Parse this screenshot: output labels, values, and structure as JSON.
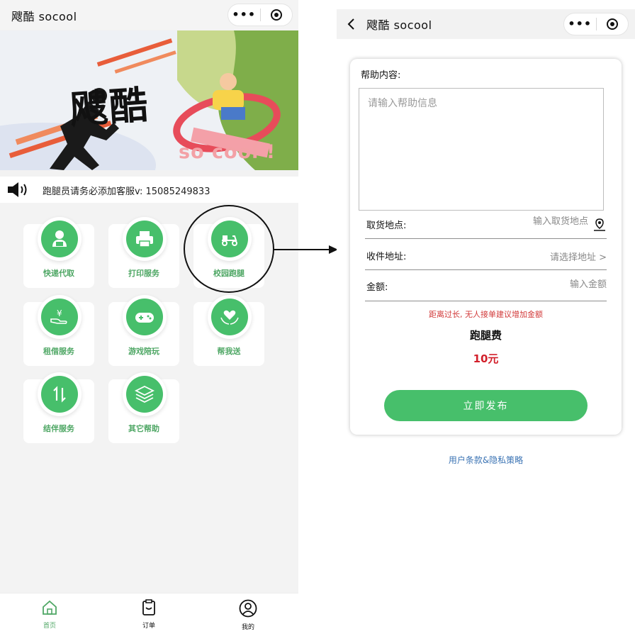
{
  "colors": {
    "brand_green": "#47bf6b",
    "label_green": "#4fa765",
    "warning_red": "#d23a3a",
    "price_red": "#d21f2a",
    "link_blue": "#3c74b4"
  },
  "home": {
    "nav": {
      "title": "飕酷 socool",
      "menu_icon": "more-dots-icon",
      "close_icon": "target-close-icon"
    },
    "banner": {
      "title": "飕酷",
      "slogan": "so cool !"
    },
    "notice": {
      "icon": "speaker-icon",
      "text": "跑腿员请务必添加客服v: 15085249833"
    },
    "services": [
      {
        "label": "快递代取",
        "icon": "courier-person-icon"
      },
      {
        "label": "打印服务",
        "icon": "printer-icon"
      },
      {
        "label": "校园跑腿",
        "icon": "scooter-icon"
      },
      {
        "label": "租借服务",
        "icon": "yen-hand-icon"
      },
      {
        "label": "游戏陪玩",
        "icon": "gamepad-icon"
      },
      {
        "label": "帮我送",
        "icon": "heart-hands-icon"
      },
      {
        "label": "结伴服务",
        "icon": "up-down-arrows-icon"
      },
      {
        "label": "其它帮助",
        "icon": "layers-icon"
      }
    ],
    "tabbar": [
      {
        "label": "首页",
        "icon": "home-icon",
        "active": true
      },
      {
        "label": "订单",
        "icon": "order-icon",
        "active": false
      },
      {
        "label": "我的",
        "icon": "user-icon",
        "active": false
      }
    ]
  },
  "form": {
    "nav": {
      "title": "飕酷 socool"
    },
    "help_label": "帮助内容:",
    "help_placeholder": "请输入帮助信息",
    "pickup": {
      "label": "取货地点:",
      "placeholder": "输入取货地点",
      "icon": "map-pin-icon"
    },
    "address": {
      "label": "收件地址:",
      "value": "请选择地址 >"
    },
    "amount": {
      "label": "金额:",
      "placeholder": "输入金额"
    },
    "warning": "距离过长, 无人接单建议增加金额",
    "fee_label": "跑腿费",
    "fee_amount": "10元",
    "submit_label": "立即发布",
    "policy_link": "用户条款&隐私策略"
  }
}
